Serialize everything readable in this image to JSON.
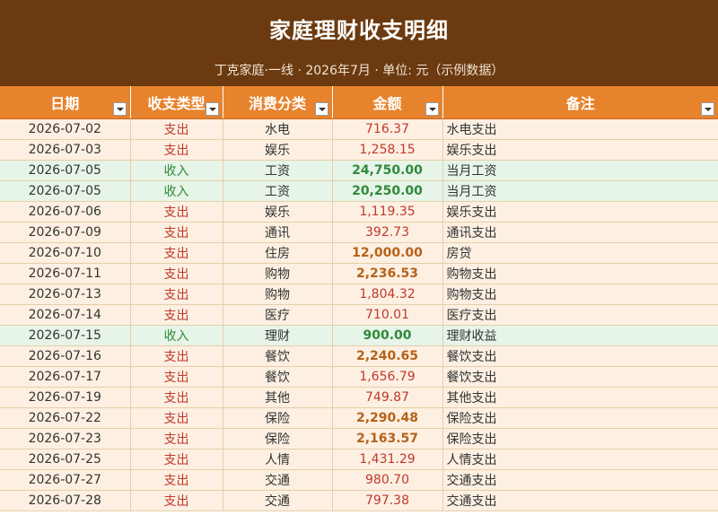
{
  "sheet": {
    "title": "家庭理财收支明细",
    "subtitle": "丁克家庭·一线 · 2026年7月 · 单位: 元（示例数据）"
  },
  "columns": [
    "日期",
    "收支类型",
    "消费分类",
    "金额",
    "备注"
  ],
  "colors": {
    "banner": "#6b3a10",
    "header": "#e8832d",
    "expense_row": "#fdf0e2",
    "income_row": "#e7f4e8",
    "expense_text": "#c0392b",
    "income_text": "#2f8a3b",
    "large_amount": "#b5621a"
  },
  "rows": [
    {
      "date": "2026-07-02",
      "type": "支出",
      "kind": "exp",
      "category": "水电",
      "amount": "716.37",
      "big": false,
      "note": "水电支出"
    },
    {
      "date": "2026-07-03",
      "type": "支出",
      "kind": "exp",
      "category": "娱乐",
      "amount": "1,258.15",
      "big": false,
      "note": "娱乐支出"
    },
    {
      "date": "2026-07-05",
      "type": "收入",
      "kind": "inc",
      "category": "工资",
      "amount": "24,750.00",
      "big": true,
      "note": "当月工资"
    },
    {
      "date": "2026-07-05",
      "type": "收入",
      "kind": "inc",
      "category": "工资",
      "amount": "20,250.00",
      "big": true,
      "note": "当月工资"
    },
    {
      "date": "2026-07-06",
      "type": "支出",
      "kind": "exp",
      "category": "娱乐",
      "amount": "1,119.35",
      "big": false,
      "note": "娱乐支出"
    },
    {
      "date": "2026-07-09",
      "type": "支出",
      "kind": "exp",
      "category": "通讯",
      "amount": "392.73",
      "big": false,
      "note": "通讯支出"
    },
    {
      "date": "2026-07-10",
      "type": "支出",
      "kind": "exp",
      "category": "住房",
      "amount": "12,000.00",
      "big": true,
      "note": "房贷"
    },
    {
      "date": "2026-07-11",
      "type": "支出",
      "kind": "exp",
      "category": "购物",
      "amount": "2,236.53",
      "big": true,
      "note": "购物支出"
    },
    {
      "date": "2026-07-13",
      "type": "支出",
      "kind": "exp",
      "category": "购物",
      "amount": "1,804.32",
      "big": false,
      "note": "购物支出"
    },
    {
      "date": "2026-07-14",
      "type": "支出",
      "kind": "exp",
      "category": "医疗",
      "amount": "710.01",
      "big": false,
      "note": "医疗支出"
    },
    {
      "date": "2026-07-15",
      "type": "收入",
      "kind": "inc",
      "category": "理财",
      "amount": "900.00",
      "big": true,
      "note": "理财收益"
    },
    {
      "date": "2026-07-16",
      "type": "支出",
      "kind": "exp",
      "category": "餐饮",
      "amount": "2,240.65",
      "big": true,
      "note": "餐饮支出"
    },
    {
      "date": "2026-07-17",
      "type": "支出",
      "kind": "exp",
      "category": "餐饮",
      "amount": "1,656.79",
      "big": false,
      "note": "餐饮支出"
    },
    {
      "date": "2026-07-19",
      "type": "支出",
      "kind": "exp",
      "category": "其他",
      "amount": "749.87",
      "big": false,
      "note": "其他支出"
    },
    {
      "date": "2026-07-22",
      "type": "支出",
      "kind": "exp",
      "category": "保险",
      "amount": "2,290.48",
      "big": true,
      "note": "保险支出"
    },
    {
      "date": "2026-07-23",
      "type": "支出",
      "kind": "exp",
      "category": "保险",
      "amount": "2,163.57",
      "big": true,
      "note": "保险支出"
    },
    {
      "date": "2026-07-25",
      "type": "支出",
      "kind": "exp",
      "category": "人情",
      "amount": "1,431.29",
      "big": false,
      "note": "人情支出"
    },
    {
      "date": "2026-07-27",
      "type": "支出",
      "kind": "exp",
      "category": "交通",
      "amount": "980.70",
      "big": false,
      "note": "交通支出"
    },
    {
      "date": "2026-07-28",
      "type": "支出",
      "kind": "exp",
      "category": "交通",
      "amount": "797.38",
      "big": false,
      "note": "交通支出"
    }
  ]
}
